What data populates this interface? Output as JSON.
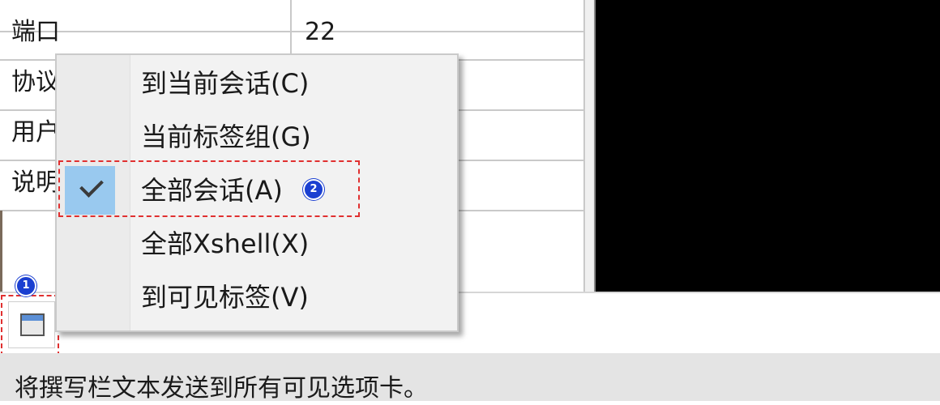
{
  "properties": {
    "rows": [
      {
        "name": "端口",
        "value": "22"
      },
      {
        "name": "协议",
        "value": ""
      },
      {
        "name": "用户",
        "value": ""
      },
      {
        "name": "说明",
        "value": ""
      }
    ]
  },
  "compose": {
    "toggle_icon": "window-icon",
    "badge": "1"
  },
  "context_menu": {
    "items": [
      {
        "label": "到当前会话(C)",
        "checked": false
      },
      {
        "label": "当前标签组(G)",
        "checked": false
      },
      {
        "label": "全部会话(A)",
        "checked": true
      },
      {
        "label": "全部Xshell(X)",
        "checked": false
      },
      {
        "label": "到可见标签(V)",
        "checked": false
      }
    ],
    "badge": "2",
    "check_icon": "checkmark-icon"
  },
  "status_bar": {
    "text": "将撰写栏文本发送到所有可见选项卡。"
  },
  "colors": {
    "highlight": "#e03030",
    "badge": "#1a3fd1",
    "checked_bg": "#99c9ef"
  }
}
